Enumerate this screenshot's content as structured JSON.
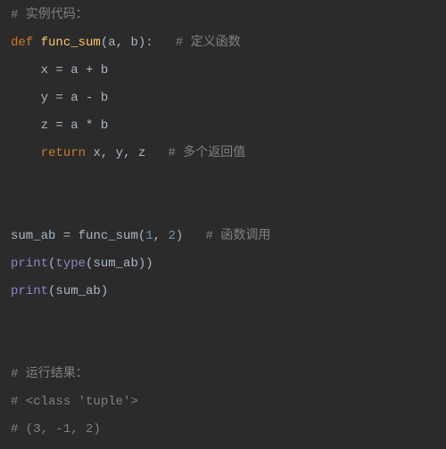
{
  "code": {
    "l1": {
      "hash": "#",
      "cmt": " 实例代码："
    },
    "l2": {
      "def": "def",
      "sp1": " ",
      "fname": "func_sum",
      "lp": "(",
      "a": "a",
      "c1": ",",
      "sp2": " ",
      "b": "b",
      "rp": ")",
      "colon": ":",
      "sp3": "   ",
      "hash": "#",
      "cmt": " 定义函数"
    },
    "l3": {
      "ind": "    ",
      "x": "x",
      "sp1": " ",
      "eq": "=",
      "sp2": " ",
      "a": "a",
      "sp3": " ",
      "op": "+",
      "sp4": " ",
      "b": "b"
    },
    "l4": {
      "ind": "    ",
      "y": "y",
      "sp1": " ",
      "eq": "=",
      "sp2": " ",
      "a": "a",
      "sp3": " ",
      "op": "-",
      "sp4": " ",
      "b": "b"
    },
    "l5": {
      "ind": "    ",
      "z": "z",
      "sp1": " ",
      "eq": "=",
      "sp2": " ",
      "a": "a",
      "sp3": " ",
      "op": "*",
      "sp4": " ",
      "b": "b"
    },
    "l6": {
      "ind": "    ",
      "ret": "return",
      "sp1": " ",
      "x": "x",
      "c1": ",",
      "sp2": " ",
      "y": "y",
      "c2": ",",
      "sp3": " ",
      "z": "z",
      "sp4": "   ",
      "hash": "#",
      "cmt": " 多个返回值"
    },
    "l9": {
      "sum": "sum_ab",
      "sp1": " ",
      "eq": "=",
      "sp2": " ",
      "fn": "func_sum",
      "lp": "(",
      "n1": "1",
      "c1": ",",
      "sp3": " ",
      "n2": "2",
      "rp": ")",
      "sp4": "   ",
      "hash": "#",
      "cmt": " 函数调用"
    },
    "l10": {
      "print": "print",
      "lp": "(",
      "type": "type",
      "lp2": "(",
      "sum": "sum_ab",
      "rp2": ")",
      "rp": ")"
    },
    "l11": {
      "print": "print",
      "lp": "(",
      "sum": "sum_ab",
      "rp": ")"
    },
    "l14": {
      "hash": "#",
      "cmt": " 运行结果："
    },
    "l15": {
      "hash": "#",
      "cmt": " <class 'tuple'>"
    },
    "l16": {
      "hash": "#",
      "cmt": " (3, -1, 2)"
    }
  }
}
